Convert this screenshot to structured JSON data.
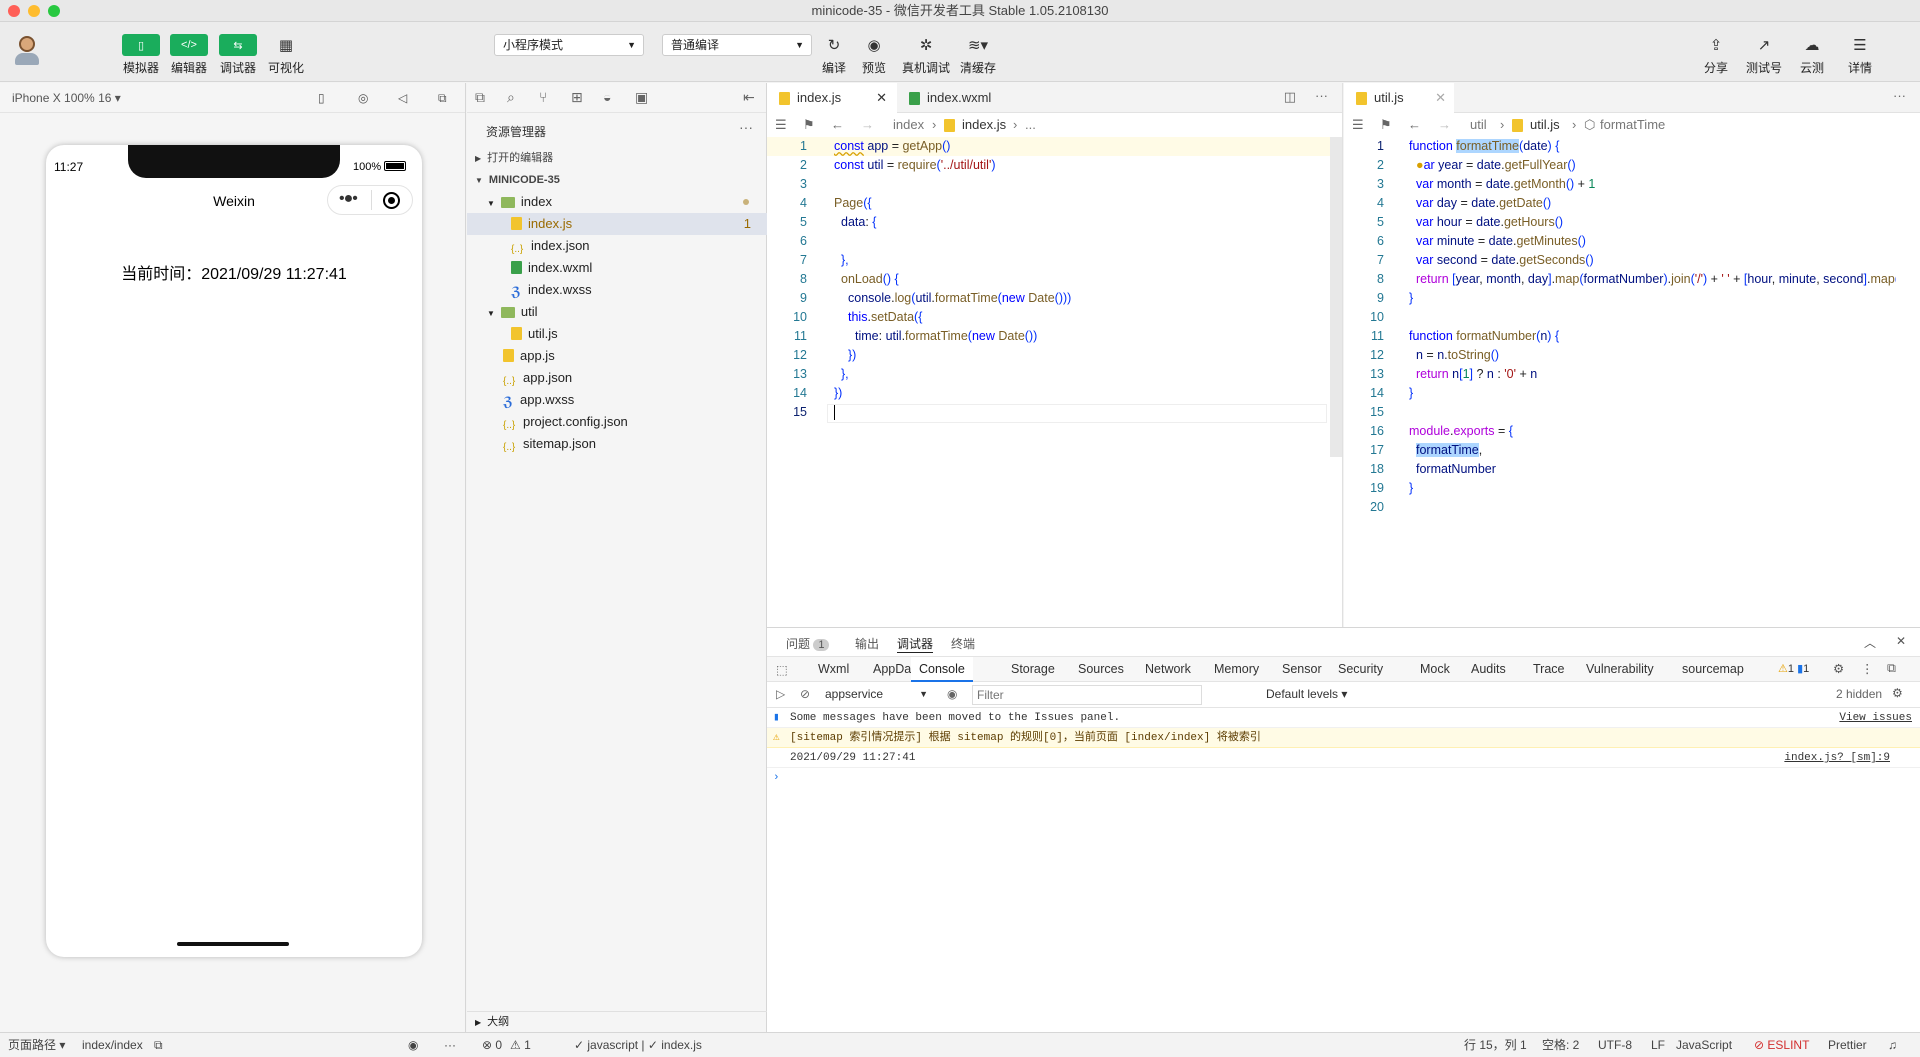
{
  "window": {
    "title": "minicode-35 - 微信开发者工具 Stable 1.05.2108130"
  },
  "colors": {
    "accent": "#1aad5c",
    "close": "#ff5f57",
    "minimize": "#febc2e",
    "zoom": "#28c840"
  },
  "toolbar": {
    "simulator": "模拟器",
    "editor": "编辑器",
    "debugger": "调试器",
    "visual": "可视化",
    "mode_select": "小程序模式",
    "compile_select": "普通编译",
    "compile": "编译",
    "preview": "预览",
    "remote_debug": "真机调试",
    "clear_cache": "清缓存",
    "share": "分享",
    "test_account": "测试号",
    "cloud": "云测",
    "details": "详情"
  },
  "simulator": {
    "device": "iPhone X 100% 16 ▾",
    "time": "11:27",
    "battery": "100%",
    "nav_title": "Weixin",
    "content": "当前时间：2021/09/29 11:27:41"
  },
  "explorer": {
    "title": "资源管理器",
    "open_editors": "打开的编辑器",
    "project": "MINICODE-35",
    "badge": "1",
    "outline": "大纲",
    "items": [
      {
        "label": "index",
        "type": "folder"
      },
      {
        "label": "index.js",
        "type": "js"
      },
      {
        "label": "index.json",
        "type": "json"
      },
      {
        "label": "index.wxml",
        "type": "wxml"
      },
      {
        "label": "index.wxss",
        "type": "wxss"
      },
      {
        "label": "util",
        "type": "folder"
      },
      {
        "label": "util.js",
        "type": "js"
      },
      {
        "label": "app.js",
        "type": "js"
      },
      {
        "label": "app.json",
        "type": "json"
      },
      {
        "label": "app.wxss",
        "type": "wxss"
      },
      {
        "label": "project.config.json",
        "type": "json"
      },
      {
        "label": "sitemap.json",
        "type": "json"
      }
    ]
  },
  "editor_left": {
    "tabs": [
      "index.js",
      "index.wxml"
    ],
    "breadcrumb": [
      "index",
      "index.js",
      "..."
    ]
  },
  "editor_right": {
    "tabs": [
      "util.js"
    ],
    "breadcrumb": [
      "util",
      "util.js",
      "formatTime"
    ]
  },
  "panel": {
    "top_tabs": [
      "问题",
      "输出",
      "调试器",
      "终端"
    ],
    "issues_count": "1",
    "devtools_tabs": [
      "Wxml",
      "AppData",
      "Console",
      "Storage",
      "Sources",
      "Network",
      "Memory",
      "Sensor",
      "Security",
      "Mock",
      "Audits",
      "Trace",
      "Vulnerability",
      "sourcemap"
    ],
    "warn_count": "1",
    "info_count": "1",
    "context": "appservice",
    "filter_placeholder": "Filter",
    "levels": "Default levels ▾",
    "hidden": "2 hidden",
    "messages": [
      {
        "text": "Some messages have been moved to the Issues panel.",
        "link": "View issues",
        "level": "info"
      },
      {
        "text": "[sitemap 索引情况提示] 根据 sitemap 的规则[0]，当前页面 [index/index] 将被索引",
        "link": "",
        "level": "warn"
      },
      {
        "text": "2021/09/29 11:27:41",
        "link": "index.js? [sm]:9",
        "level": "log"
      }
    ],
    "prompt": "›"
  },
  "status": {
    "page_path_label": "页面路径 ▾",
    "page_path": "index/index",
    "errors": "⊗ 0",
    "warnings": "⚠ 1",
    "lang_left": "✓ javascript | ✓ index.js",
    "position": "行 15，列 1",
    "spaces": "空格: 2",
    "encoding": "UTF-8",
    "eol": "LF",
    "language": "JavaScript",
    "eslint": "⊘ ESLINT",
    "prettier": "Prettier"
  }
}
